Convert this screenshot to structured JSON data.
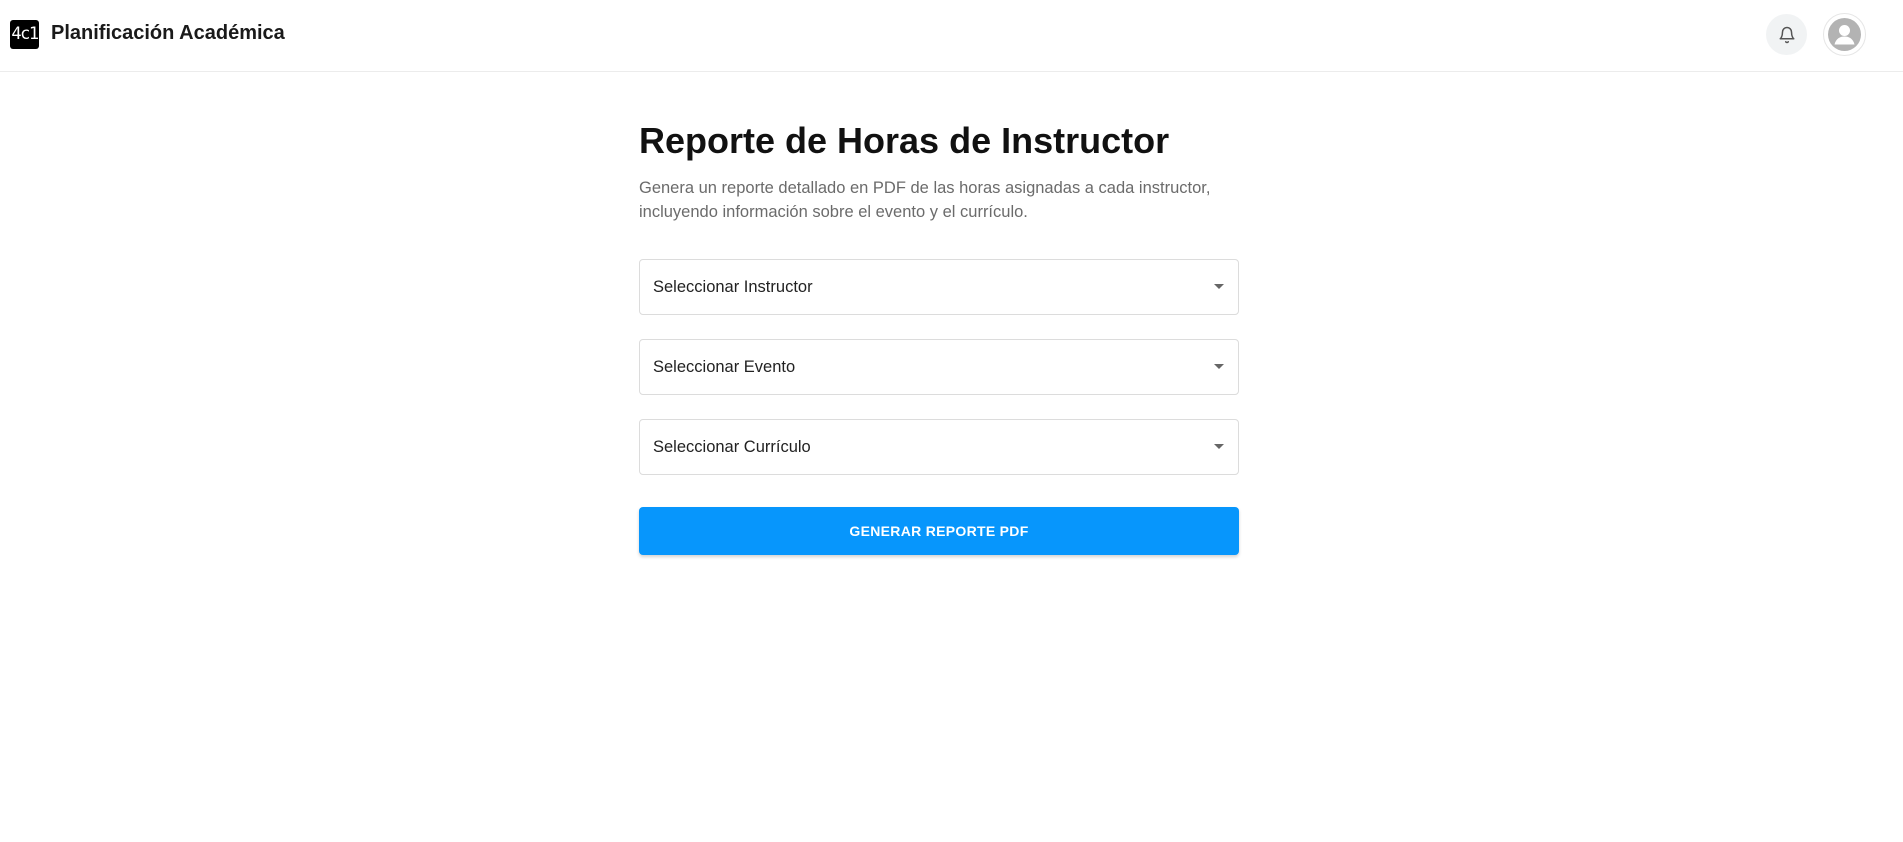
{
  "header": {
    "logo_text": "4c1",
    "app_title": "Planificación Académica",
    "notifications_icon": "bell-icon",
    "profile_icon": "user-avatar-icon"
  },
  "main": {
    "title": "Reporte de Horas de Instructor",
    "description": "Genera un reporte detallado en PDF de las horas asignadas a cada instructor, incluyendo información sobre el evento y el currículo.",
    "selects": [
      {
        "label": "Seleccionar Instructor"
      },
      {
        "label": "Seleccionar Evento"
      },
      {
        "label": "Seleccionar Currículo"
      }
    ],
    "generate_button_label": "GENERAR REPORTE PDF"
  },
  "colors": {
    "primary": "#0796fc",
    "title_text": "#111111",
    "description_text": "#6b6b6b",
    "border": "#dcdcdc"
  }
}
